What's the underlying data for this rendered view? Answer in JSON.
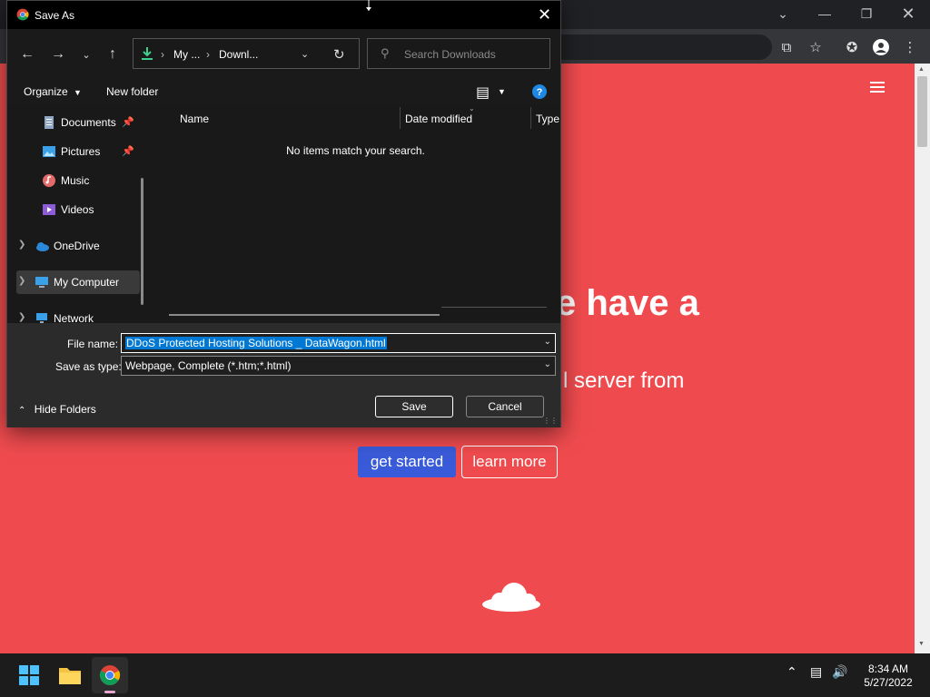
{
  "browser": {
    "page": {
      "hero_title": "e have a",
      "hero_subtitle": "l server from",
      "btn_get_started": "get started",
      "btn_learn_more": "learn more"
    }
  },
  "dialog": {
    "title": "Save As",
    "breadcrumb": [
      "My ...",
      "Downl..."
    ],
    "search_placeholder": "Search Downloads",
    "organize_label": "Organize",
    "new_folder_label": "New folder",
    "nav_items": [
      {
        "label": "Documents",
        "pinned": true
      },
      {
        "label": "Pictures",
        "pinned": true
      },
      {
        "label": "Music",
        "pinned": false
      },
      {
        "label": "Videos",
        "pinned": false
      },
      {
        "label": "OneDrive",
        "pinned": false
      },
      {
        "label": "My Computer",
        "pinned": false
      },
      {
        "label": "Network",
        "pinned": false
      }
    ],
    "columns": [
      "Name",
      "Date modified",
      "Type"
    ],
    "empty_message": "No items match your search.",
    "file_name_label": "File name:",
    "file_name_value": "DDoS Protected Hosting Solutions _ DataWagon.html",
    "save_type_label": "Save as type:",
    "save_type_value": "Webpage, Complete (*.htm;*.html)",
    "hide_folders_label": "Hide Folders",
    "save_label": "Save",
    "cancel_label": "Cancel"
  },
  "taskbar": {
    "time": "8:34 AM",
    "date": "5/27/2022"
  },
  "colors": {
    "page_background": "#ef4b4e",
    "accent_blue": "#0078d4",
    "cta_blue": "#3a5bd9"
  }
}
